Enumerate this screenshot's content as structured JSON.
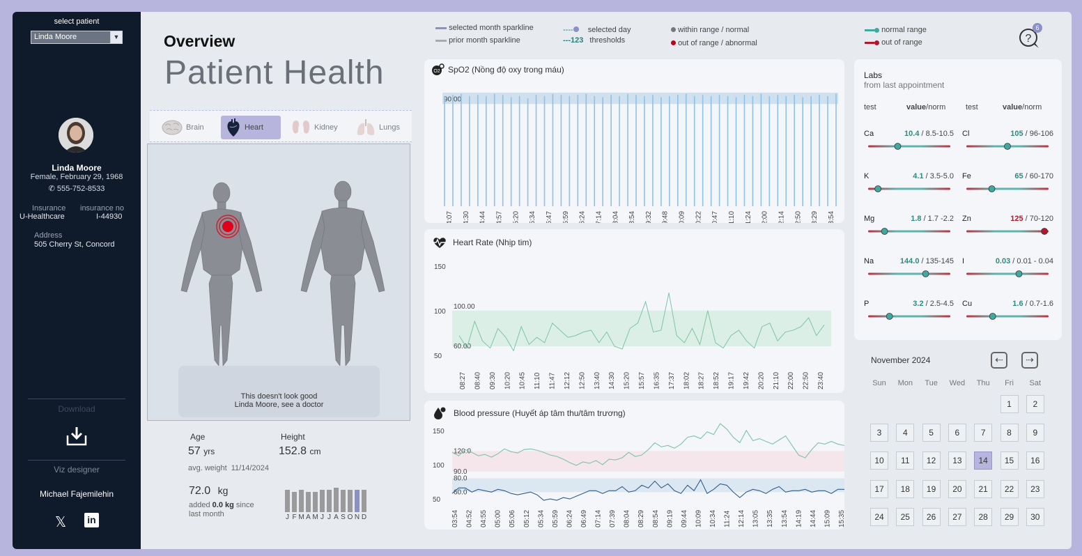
{
  "sidebar": {
    "select_label": "select patient",
    "selected_patient": "Linda Moore",
    "name": "Linda Moore",
    "gender_dob": "Female, February 29, 1968",
    "phone": "555-752-8533",
    "insurance_label": "Insurance",
    "insurance_no_label": "insurance no",
    "insurance": "U-Healthcare",
    "insurance_no": "I-44930",
    "address_label": "Address",
    "address": "505 Cherry St, Concord",
    "download_label": "Download",
    "viz_designer_label": "Viz designer",
    "designer": "Michael Fajemilehin",
    "social": [
      "x-icon",
      "linkedin-icon"
    ]
  },
  "header": {
    "overview": "Overview",
    "title": "Patient Health",
    "help_badge": "6"
  },
  "legend": {
    "selected_month": "selected month sparkline",
    "prior_month": "prior month  sparkline",
    "selected_day": "selected day",
    "thresholds": "thresholds",
    "threshold_sample": "---123",
    "within_range": "within range / normal",
    "out_of_range": "out of range / abnormal",
    "normal_range": "normal range",
    "out_range": "out of range"
  },
  "organs": {
    "tabs": [
      {
        "label": "Brain",
        "icon": "brain-icon"
      },
      {
        "label": "Heart",
        "icon": "heart-icon"
      },
      {
        "label": "Kidney",
        "icon": "kidney-icon"
      },
      {
        "label": "Lungs",
        "icon": "lungs-icon"
      }
    ],
    "active": "Heart",
    "warning_line1": "This doesn't look good",
    "warning_line2": "Linda Moore, see a doctor"
  },
  "stats": {
    "age_label": "Age",
    "age": "57",
    "age_unit": "yrs",
    "height_label": "Height",
    "height": "152.8",
    "height_unit": "cm",
    "avg_weight_label": "avg. weight",
    "avg_weight_date": "11/14/2024",
    "weight": "72.0",
    "weight_unit": "kg",
    "added_label": "added",
    "added_value": "0.0 kg",
    "since_label": "since",
    "last_month": "last month",
    "month_letters": [
      "J",
      "F",
      "M",
      "A",
      "M",
      "J",
      "J",
      "A",
      "S",
      "O",
      "N",
      "D"
    ],
    "monthly_weights": [
      68,
      67,
      68,
      67,
      67,
      68,
      68,
      69,
      68,
      68,
      68,
      68
    ]
  },
  "labs": {
    "title": "Labs",
    "subtitle": "from last appointment",
    "col_test": "test",
    "col_value": "value",
    "col_norm": "/norm",
    "items": [
      {
        "test": "Ca",
        "value": "10.4",
        "norm": " / 8.5-10.5",
        "pos": 0.36,
        "abnormal": false
      },
      {
        "test": "Cl",
        "value": "105",
        "norm": " / 96-106",
        "pos": 0.5,
        "abnormal": false
      },
      {
        "test": "K",
        "value": "4.1",
        "norm": " / 3.5-5.0",
        "pos": 0.12,
        "abnormal": false
      },
      {
        "test": "Fe",
        "value": "65",
        "norm": " / 60-170",
        "pos": 0.31,
        "abnormal": false
      },
      {
        "test": "Mg",
        "value": "1.8",
        "norm": " / 1.7 -2.2",
        "pos": 0.2,
        "abnormal": false
      },
      {
        "test": "Zn",
        "value": "125",
        "norm": " / 70-120",
        "pos": 0.95,
        "abnormal": true
      },
      {
        "test": "Na",
        "value": "144.0",
        "norm": " / 135-145",
        "pos": 0.7,
        "abnormal": false
      },
      {
        "test": "I",
        "value": "0.03",
        "norm": " / 0.01 - 0.04",
        "pos": 0.64,
        "abnormal": false
      },
      {
        "test": "P",
        "value": "3.2",
        "norm": " / 2.5-4.5",
        "pos": 0.26,
        "abnormal": false
      },
      {
        "test": "Cu",
        "value": "1.6",
        "norm": " / 0.7-1.6",
        "pos": 0.32,
        "abnormal": false
      }
    ]
  },
  "calendar": {
    "month": "November 2024",
    "dow": [
      "Sun",
      "Mon",
      "Tue",
      "Wed",
      "Thu",
      "Fri",
      "Sat"
    ],
    "start_offset": 5,
    "days": 30,
    "selected": 14
  },
  "chart_data": [
    {
      "type": "bar",
      "title": "SpO2 (Nồng độ oxy trong máu)",
      "threshold_label": "90.00",
      "threshold": 90,
      "ylim": [
        0,
        100
      ],
      "categories": [
        "14:07",
        "14:30",
        "14:44",
        "14:57",
        "15:20",
        "15:34",
        "15:47",
        "15:59",
        "16:24",
        "17:14",
        "18:04",
        "18:54",
        "19:32",
        "19:48",
        "20:09",
        "20:22",
        "20:47",
        "21:10",
        "21:24",
        "22:00",
        "22:14",
        "22:50",
        "23:29",
        "23:54"
      ],
      "values": [
        97,
        98,
        99,
        97,
        98,
        97,
        99,
        98,
        96,
        97,
        95,
        98,
        97,
        99,
        98,
        97,
        98,
        99,
        97,
        96,
        98,
        97,
        99,
        98,
        97,
        98,
        96,
        97,
        98,
        99,
        97,
        98,
        97,
        98,
        97,
        96,
        98,
        97,
        99,
        97,
        98,
        97,
        98,
        96,
        97,
        98,
        97,
        99
      ]
    },
    {
      "type": "line",
      "title": "Heart Rate (Nhịp tim)",
      "y_ticks": [
        "150",
        "100",
        "50"
      ],
      "ylim": [
        35,
        160
      ],
      "band": [
        60,
        100
      ],
      "band_labels": [
        "100.00",
        "60.00"
      ],
      "categories": [
        "08:27",
        "08:40",
        "09:30",
        "10:20",
        "10:45",
        "11:10",
        "11:47",
        "12:12",
        "12:50",
        "13:40",
        "14:30",
        "15:20",
        "15:57",
        "16:35",
        "17:37",
        "18:02",
        "18:27",
        "18:52",
        "19:17",
        "19:42",
        "20:20",
        "21:10",
        "22:00",
        "22:50",
        "23:40"
      ],
      "values": [
        72,
        58,
        88,
        66,
        58,
        80,
        70,
        55,
        82,
        62,
        70,
        64,
        86,
        78,
        70,
        72,
        76,
        78,
        64,
        76,
        60,
        57,
        80,
        86,
        110,
        76,
        78,
        120,
        72,
        64,
        80,
        62,
        100,
        64,
        58,
        72,
        78,
        66,
        58,
        82,
        86,
        66,
        76,
        78,
        82,
        92,
        72,
        84
      ]
    },
    {
      "type": "line",
      "title": "Blood pressure (Huyết áp tâm thu/tâm trương)",
      "y_ticks": [
        "150",
        "100",
        "50"
      ],
      "ylim": [
        45,
        165
      ],
      "bands": [
        {
          "range": [
            90,
            120
          ],
          "labels": [
            "120.0",
            "90.0"
          ]
        },
        {
          "range": [
            60,
            80
          ],
          "labels": [
            "80.0",
            "60.0"
          ]
        }
      ],
      "categories": [
        "03:54",
        "04:52",
        "04:55",
        "05:00",
        "05:06",
        "05:12",
        "05:34",
        "05:59",
        "06:24",
        "06:49",
        "07:14",
        "07:39",
        "08:04",
        "08:29",
        "08:54",
        "09:19",
        "09:44",
        "10:09",
        "10:34",
        "11:24",
        "12:14",
        "13:05",
        "13:35",
        "13:54",
        "14:19",
        "14:44",
        "15:09",
        "15:35"
      ],
      "series": [
        {
          "name": "systolic",
          "values": [
            118,
            113,
            122,
            118,
            113,
            115,
            111,
            116,
            123,
            119,
            117,
            122,
            123,
            121,
            118,
            114,
            112,
            108,
            103,
            99,
            104,
            102,
            106,
            100,
            108,
            107,
            110,
            118,
            112,
            114,
            122,
            132,
            126,
            128,
            124,
            130,
            140,
            142,
            138,
            148,
            144,
            160,
            152,
            140,
            132,
            150,
            135,
            138,
            134,
            130,
            136,
            142,
            128,
            114,
            110,
            122,
            132,
            130,
            134,
            130,
            128
          ]
        },
        {
          "name": "diastolic",
          "values": [
            58,
            66,
            66,
            60,
            64,
            62,
            60,
            64,
            62,
            58,
            56,
            58,
            60,
            56,
            48,
            50,
            48,
            52,
            50,
            54,
            58,
            62,
            62,
            58,
            62,
            62,
            68,
            60,
            62,
            70,
            66,
            76,
            66,
            72,
            62,
            58,
            70,
            62,
            78,
            58,
            64,
            72,
            70,
            60,
            52,
            60,
            64,
            62,
            58,
            64,
            68,
            60,
            62,
            62,
            64,
            60,
            62,
            62,
            58,
            64,
            64
          ]
        }
      ]
    }
  ]
}
